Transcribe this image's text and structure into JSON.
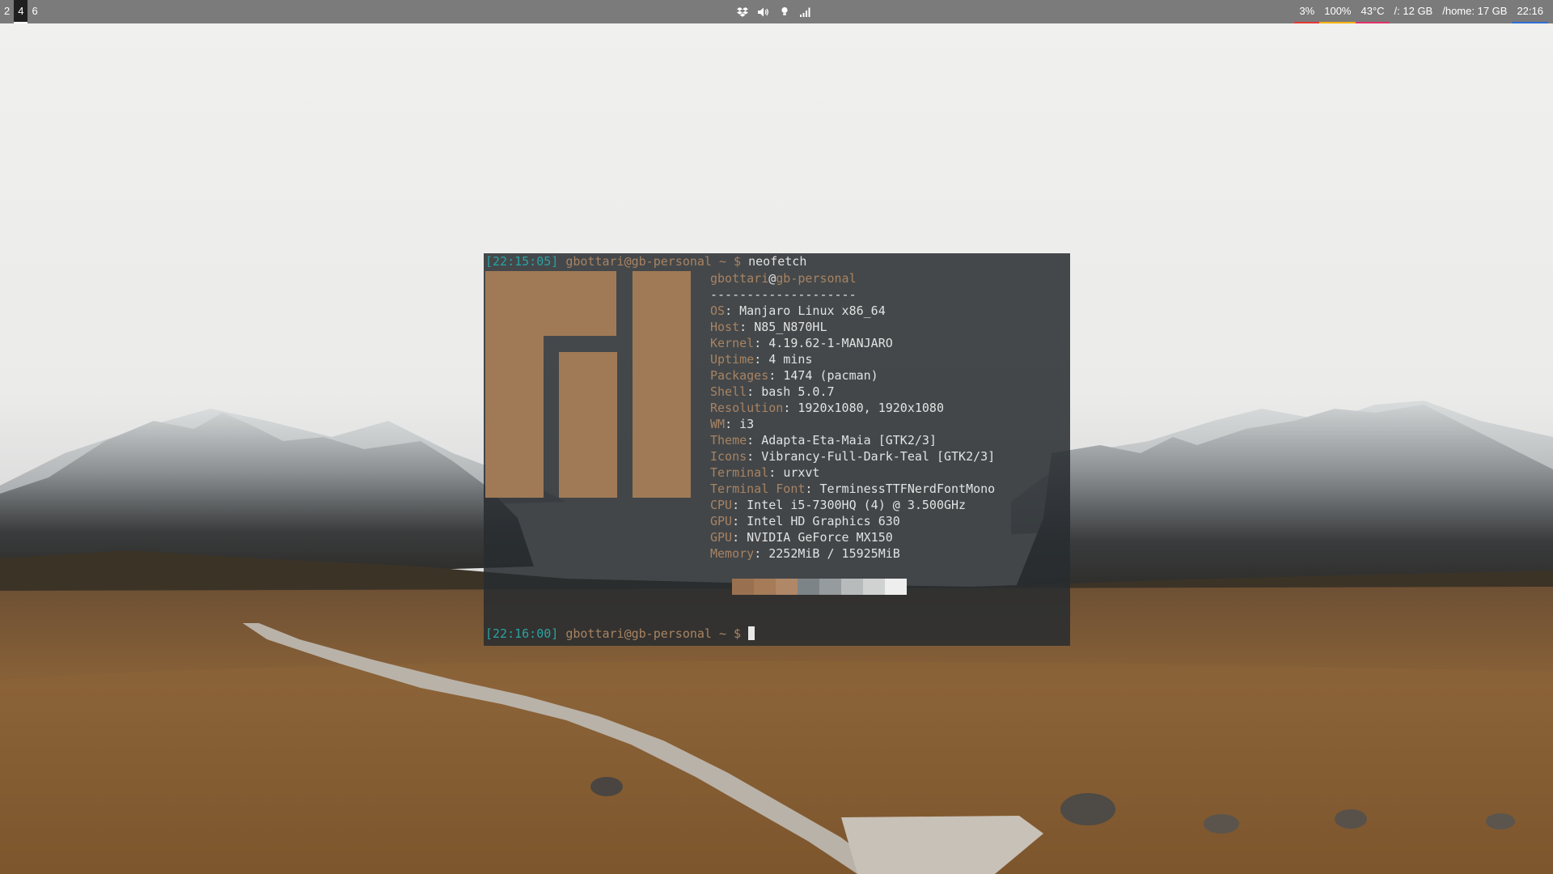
{
  "topbar": {
    "workspaces": [
      {
        "label": "2",
        "active": false
      },
      {
        "label": "4",
        "active": true
      },
      {
        "label": "6",
        "active": false
      }
    ],
    "tray_icons": [
      "dropbox-icon",
      "volume-icon",
      "bulb-icon",
      "signal-icon"
    ],
    "modules": [
      {
        "name": "cpu",
        "text": "3%",
        "underline": "#e53935"
      },
      {
        "name": "battery",
        "text": "100%",
        "underline": "#f5b400"
      },
      {
        "name": "temperature",
        "text": "43°C",
        "underline": "#e0336a"
      },
      {
        "name": "disk-root",
        "text": "/: 12 GB",
        "underline": ""
      },
      {
        "name": "disk-home",
        "text": "/home: 17 GB",
        "underline": ""
      },
      {
        "name": "clock",
        "text": "22:16",
        "underline": "#2f6fd6"
      }
    ]
  },
  "terminal": {
    "prompt1": {
      "time": "[22:15:05]",
      "user": "gbottari@gb-personal",
      "path": " ~ $ ",
      "command": "neofetch"
    },
    "header": {
      "user": "gbottari",
      "at": "@",
      "host": "gb-personal",
      "separator": "--------------------"
    },
    "info": [
      {
        "key": "OS",
        "value": "Manjaro Linux x86_64"
      },
      {
        "key": "Host",
        "value": "N85_N870HL"
      },
      {
        "key": "Kernel",
        "value": "4.19.62-1-MANJARO"
      },
      {
        "key": "Uptime",
        "value": "4 mins"
      },
      {
        "key": "Packages",
        "value": "1474 (pacman)"
      },
      {
        "key": "Shell",
        "value": "bash 5.0.7"
      },
      {
        "key": "Resolution",
        "value": "1920x1080, 1920x1080"
      },
      {
        "key": "WM",
        "value": "i3"
      },
      {
        "key": "Theme",
        "value": "Adapta-Eta-Maia [GTK2/3]"
      },
      {
        "key": "Icons",
        "value": "Vibrancy-Full-Dark-Teal [GTK2/3]"
      },
      {
        "key": "Terminal",
        "value": "urxvt"
      },
      {
        "key": "Terminal Font",
        "value": "TerminessTTFNerdFontMono"
      },
      {
        "key": "CPU",
        "value": "Intel i5-7300HQ (4) @ 3.500GHz"
      },
      {
        "key": "GPU",
        "value": "Intel HD Graphics 630"
      },
      {
        "key": "GPU",
        "value": "NVIDIA GeForce MX150"
      },
      {
        "key": "Memory",
        "value": "2252MiB / 15925MiB"
      }
    ],
    "palette": [
      "#9a7150",
      "#a57b58",
      "#b08867",
      "#7d8488",
      "#969b9d",
      "#b7bbbc",
      "#d0d2d2",
      "#eeeeee"
    ],
    "prompt2": {
      "time": "[22:16:00]",
      "user": "gbottari@gb-personal",
      "path": " ~ $ "
    },
    "colors": {
      "teal": "#2aa3a3",
      "tan": "#a88362",
      "logo": "#a07a56"
    }
  }
}
